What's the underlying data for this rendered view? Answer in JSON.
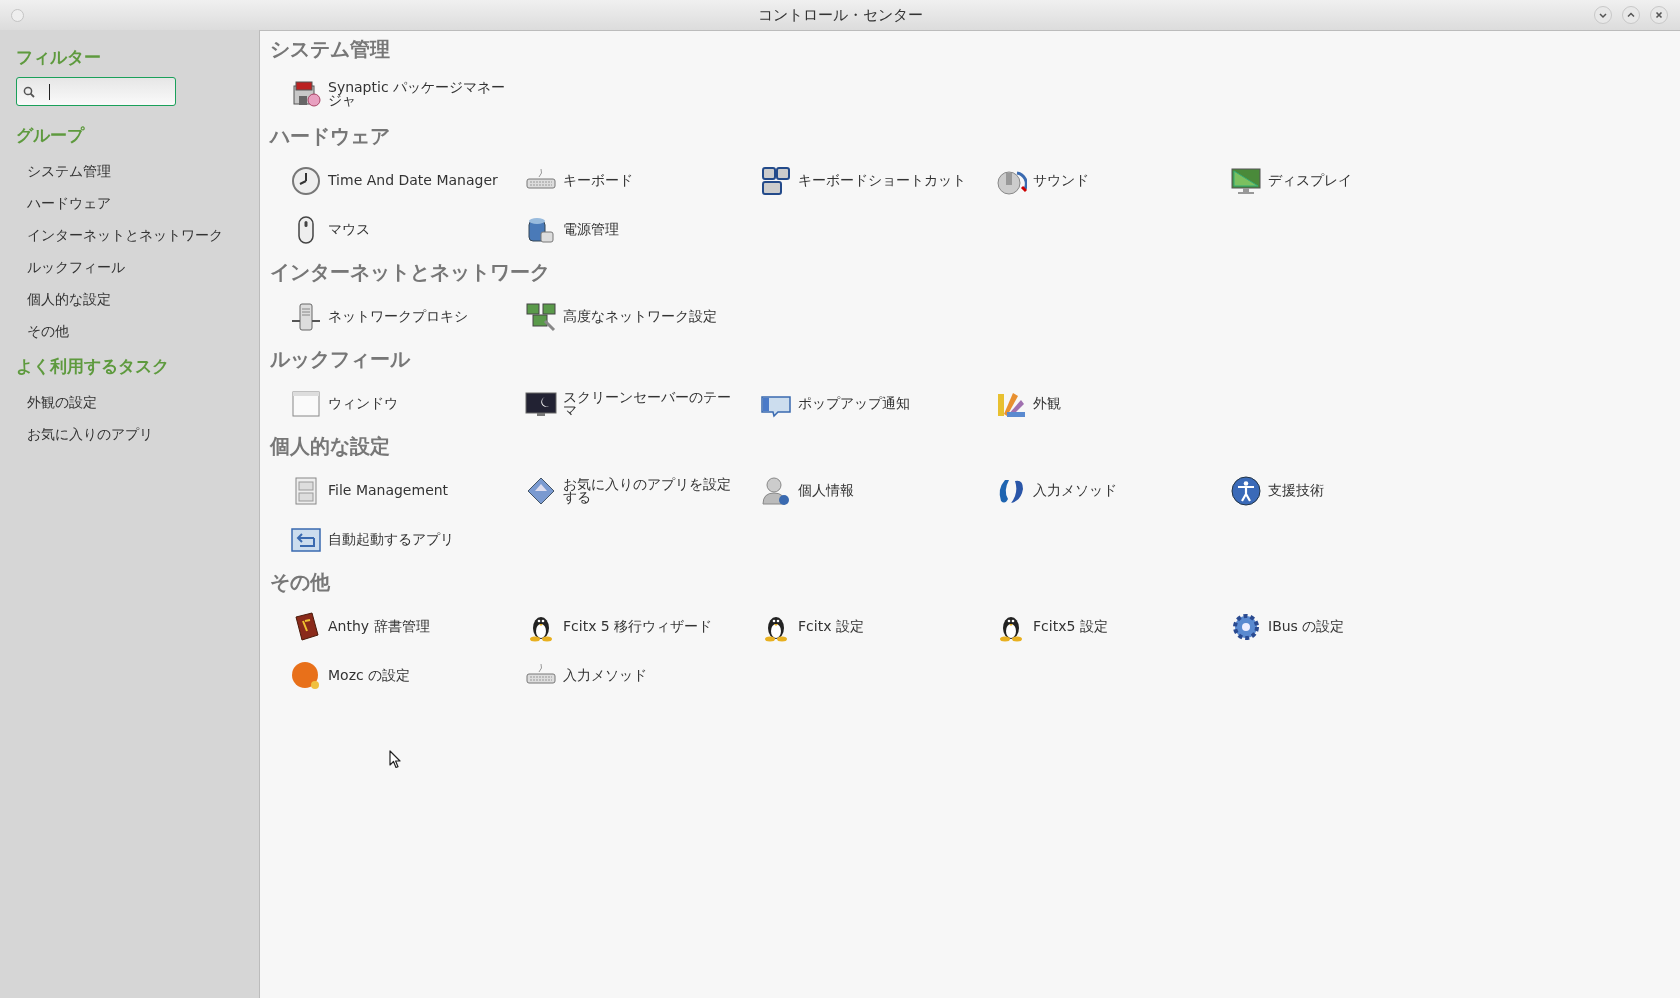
{
  "window": {
    "title": "コントロール・センター"
  },
  "sidebar": {
    "filter_heading": "フィルター",
    "search": {
      "focused": true
    },
    "groups_heading": "グループ",
    "groups": [
      {
        "label": "システム管理"
      },
      {
        "label": "ハードウェア"
      },
      {
        "label": "インターネットとネットワーク"
      },
      {
        "label": "ルックフィール"
      },
      {
        "label": "個人的な設定"
      },
      {
        "label": "その他"
      }
    ],
    "tasks_heading": "よく利用するタスク",
    "tasks": [
      {
        "label": "外観の設定"
      },
      {
        "label": "お気に入りのアプリ"
      }
    ]
  },
  "sections": [
    {
      "title": "システム管理",
      "items": [
        {
          "label": "Synaptic パッケージマネージャ"
        }
      ]
    },
    {
      "title": "ハードウェア",
      "items": [
        {
          "label": "Time And Date Manager"
        },
        {
          "label": "キーボード"
        },
        {
          "label": "キーボードショートカット"
        },
        {
          "label": "サウンド"
        },
        {
          "label": "ディスプレイ"
        },
        {
          "label": "マウス"
        },
        {
          "label": "電源管理"
        }
      ]
    },
    {
      "title": "インターネットとネットワーク",
      "items": [
        {
          "label": "ネットワークプロキシ"
        },
        {
          "label": "高度なネットワーク設定"
        }
      ]
    },
    {
      "title": "ルックフィール",
      "items": [
        {
          "label": "ウィンドウ"
        },
        {
          "label": "スクリーンセーバーのテーマ"
        },
        {
          "label": "ポップアップ通知"
        },
        {
          "label": "外観"
        }
      ]
    },
    {
      "title": "個人的な設定",
      "items": [
        {
          "label": "File Management"
        },
        {
          "label": "お気に入りのアプリを設定する"
        },
        {
          "label": "個人情報"
        },
        {
          "label": "入力メソッド"
        },
        {
          "label": "支援技術"
        },
        {
          "label": "自動起動するアプリ"
        }
      ]
    },
    {
      "title": "その他",
      "items": [
        {
          "label": "Anthy 辞書管理"
        },
        {
          "label": "Fcitx 5 移行ウィザード"
        },
        {
          "label": "Fcitx 設定"
        },
        {
          "label": "Fcitx5 設定"
        },
        {
          "label": "IBus の設定"
        },
        {
          "label": "Mozc の設定"
        },
        {
          "label": "入力メソッド"
        }
      ]
    }
  ]
}
